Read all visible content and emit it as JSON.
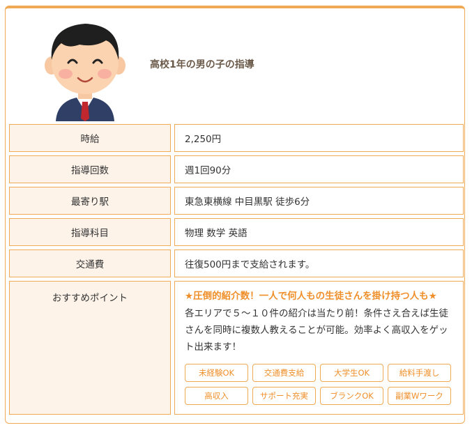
{
  "header": {
    "title": "高校1年の男の子の指導"
  },
  "rows": [
    {
      "label": "時給",
      "value": "2,250円"
    },
    {
      "label": "指導回数",
      "value": "週1回90分"
    },
    {
      "label": "最寄り駅",
      "value": "東急東横線 中目黒駅 徒歩6分"
    },
    {
      "label": "指導科目",
      "value": "物理 数学 英語"
    },
    {
      "label": "交通費",
      "value": "往復500円まで支給されます。"
    }
  ],
  "recommend": {
    "label": "おすすめポイント",
    "headline": "★圧倒的紹介数！一人で何人もの生徒さんを掛け持つ人も★",
    "body": "各エリアで５～１０件の紹介は当たり前！条件さえ合えば生徒さんを同時に複数人教えることが可能。効率よく高収入をゲット出来ます！",
    "tags": [
      "未経験OK",
      "交通費支給",
      "大学生OK",
      "給料手渡し",
      "高収入",
      "サポート充実",
      "ブランクOK",
      "副業Wワーク"
    ]
  },
  "colors": {
    "accent": "#f0a955",
    "label_bg": "#fdf3e9",
    "tag_text": "#ef8f2a"
  }
}
